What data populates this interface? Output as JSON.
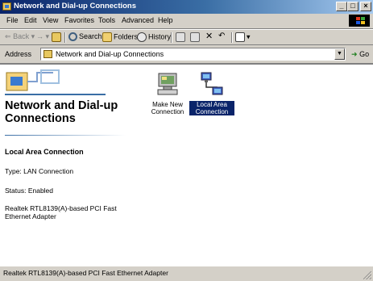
{
  "window": {
    "title": "Network and Dial-up Connections"
  },
  "menubar": {
    "items": [
      {
        "label": "File"
      },
      {
        "label": "Edit"
      },
      {
        "label": "View"
      },
      {
        "label": "Favorites"
      },
      {
        "label": "Tools"
      },
      {
        "label": "Advanced"
      },
      {
        "label": "Help"
      }
    ]
  },
  "toolbar": {
    "back_label": "Back",
    "search_label": "Search",
    "folders_label": "Folders",
    "history_label": "History"
  },
  "address": {
    "label": "Address",
    "value": "Network and Dial-up Connections",
    "go_label": "Go"
  },
  "left_panel": {
    "title": "Network and Dial-up Connections",
    "selected_name": "Local Area Connection",
    "type_line": "Type: LAN Connection",
    "status_line": "Status: Enabled",
    "adapter_line": "Realtek RTL8139(A)-based PCI Fast Ethernet Adapter"
  },
  "icons": [
    {
      "label": "Make New Connection",
      "icon": "make-new-connection-icon"
    },
    {
      "label": "Local Area Connection",
      "icon": "lan-connection-icon"
    }
  ],
  "statusbar": {
    "text": "Realtek RTL8139(A)-based PCI Fast Ethernet Adapter"
  }
}
